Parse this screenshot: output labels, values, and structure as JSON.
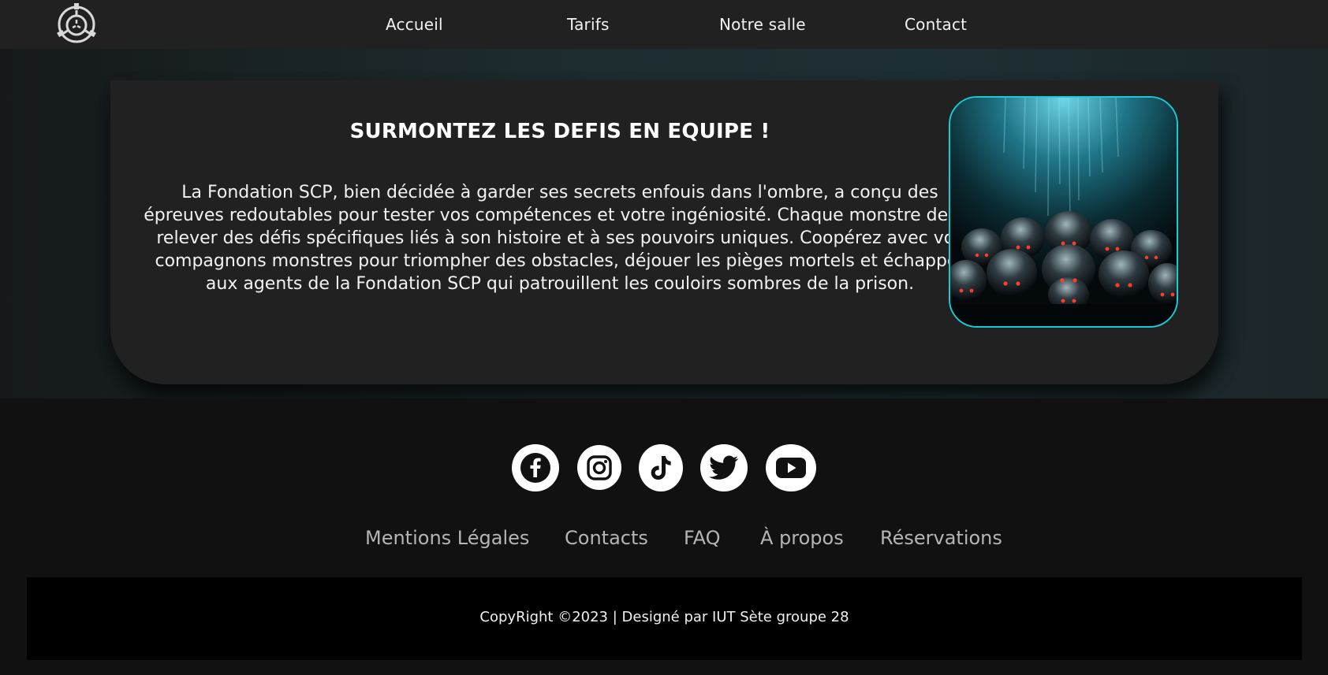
{
  "nav": {
    "logo_icon": "scp-foundation-logo-icon",
    "items": [
      "Accueil",
      "Tarifs",
      "Notre salle",
      "Contact"
    ]
  },
  "section": {
    "title": "SURMONTEZ LES DEFIS EN EQUIPE !",
    "paragraph": "La Fondation SCP, bien décidée à garder ses secrets enfouis dans l'ombre, a conçu des épreuves redoutables pour tester vos compétences et votre ingéniosité. Chaque monstre devra relever des défis spécifiques liés à son histoire et à ses pouvoirs uniques. Coopérez avec vos compagnons monstres pour triompher des obstacles, déjouer les pièges mortels et échapper aux agents de la Fondation SCP qui patrouillent les couloirs sombres de la prison.",
    "image_icon": "monsters-illustration-image"
  },
  "footer": {
    "social": [
      "facebook-icon",
      "instagram-icon",
      "tiktok-icon",
      "twitter-icon",
      "youtube-icon"
    ],
    "links": [
      "Mentions Légales",
      "Contacts",
      "FAQ",
      "À propos",
      "Réservations"
    ],
    "copyright": "CopyRight ©2023 | Designé par IUT Sète groupe 28"
  },
  "colors": {
    "navbar_bg": "#212121",
    "card_bg": "#212121",
    "accent_teal": "#19c9d4",
    "footer_bg": "#111111",
    "copyright_bg": "#000000",
    "footer_link": "#b5b5b5"
  }
}
